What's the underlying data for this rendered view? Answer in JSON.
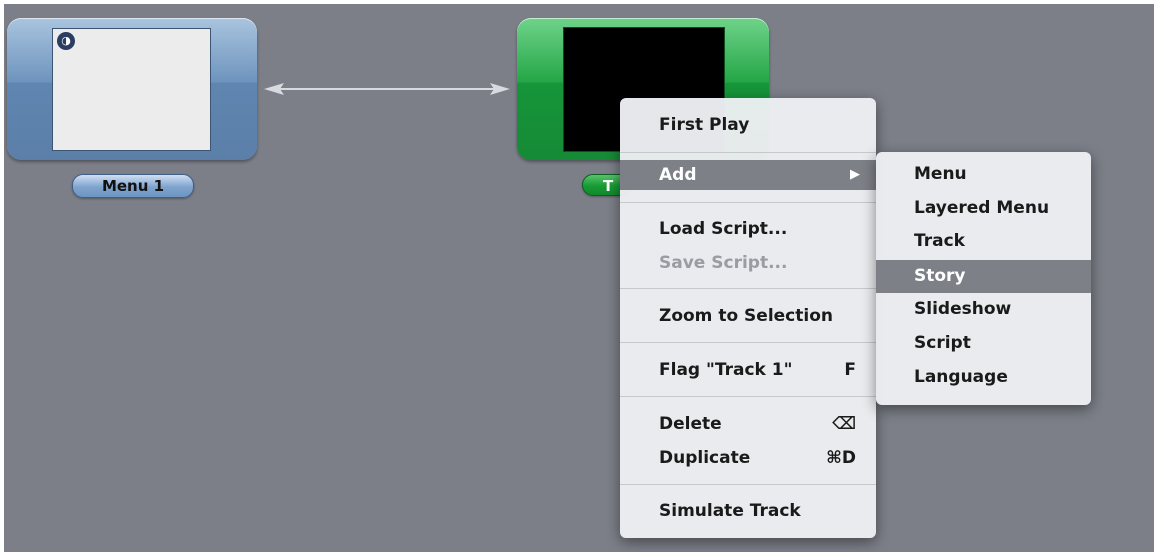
{
  "canvas": {
    "menu_tile": {
      "label": "Menu 1",
      "icon": "dvd-icon"
    },
    "track_tile": {
      "label": "Track 1",
      "visible_label": "T"
    }
  },
  "context_menu": {
    "items": [
      {
        "label": "First Play",
        "shortcut": "",
        "disabled": false
      },
      {
        "label": "Add",
        "shortcut": "▶",
        "disabled": false,
        "highlighted": true
      },
      {
        "label": "Load Script...",
        "shortcut": "",
        "disabled": false
      },
      {
        "label": "Save Script...",
        "shortcut": "",
        "disabled": true
      },
      {
        "label": "Zoom to Selection",
        "shortcut": "",
        "disabled": false
      },
      {
        "label": "Flag \"Track 1\"",
        "shortcut": "F",
        "disabled": false
      },
      {
        "label": "Delete",
        "shortcut": "⌫",
        "disabled": false
      },
      {
        "label": "Duplicate",
        "shortcut": "⌘D",
        "disabled": false
      },
      {
        "label": "Simulate Track",
        "shortcut": "",
        "disabled": false
      }
    ]
  },
  "submenu": {
    "items": [
      {
        "label": "Menu"
      },
      {
        "label": "Layered Menu"
      },
      {
        "label": "Track"
      },
      {
        "label": "Story",
        "highlighted": true
      },
      {
        "label": "Slideshow"
      },
      {
        "label": "Script"
      },
      {
        "label": "Language"
      }
    ]
  },
  "colors": {
    "canvas": "#7c7f88",
    "menu_tile": "#6e94bd",
    "track_tile": "#25a647",
    "highlight": "#7d8087"
  }
}
